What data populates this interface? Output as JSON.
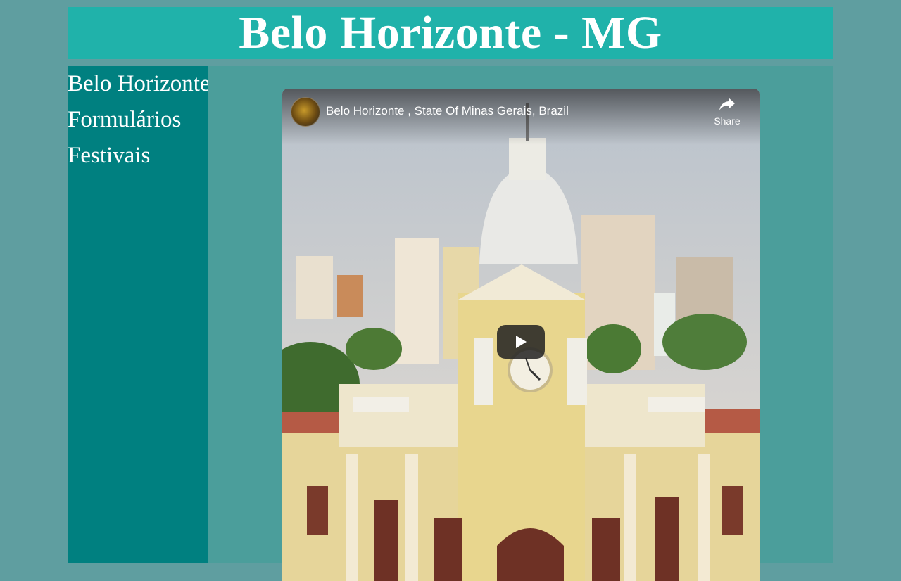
{
  "header": {
    "title": "Belo Horizonte - MG"
  },
  "sidebar": {
    "items": [
      {
        "label": "Belo Horizonte"
      },
      {
        "label": "Formulários"
      },
      {
        "label": "Festivais"
      }
    ]
  },
  "video": {
    "title": "Belo Horizonte , State Of Minas Gerais, Brazil",
    "share_label": "Share",
    "play_icon": "play-icon",
    "share_icon": "share-arrow-icon"
  },
  "colors": {
    "page_background": "#5f9ea0",
    "header_background": "#20b2aa",
    "sidebar_background": "#008080",
    "main_background": "#4b9e9b",
    "text": "#ffffff"
  }
}
